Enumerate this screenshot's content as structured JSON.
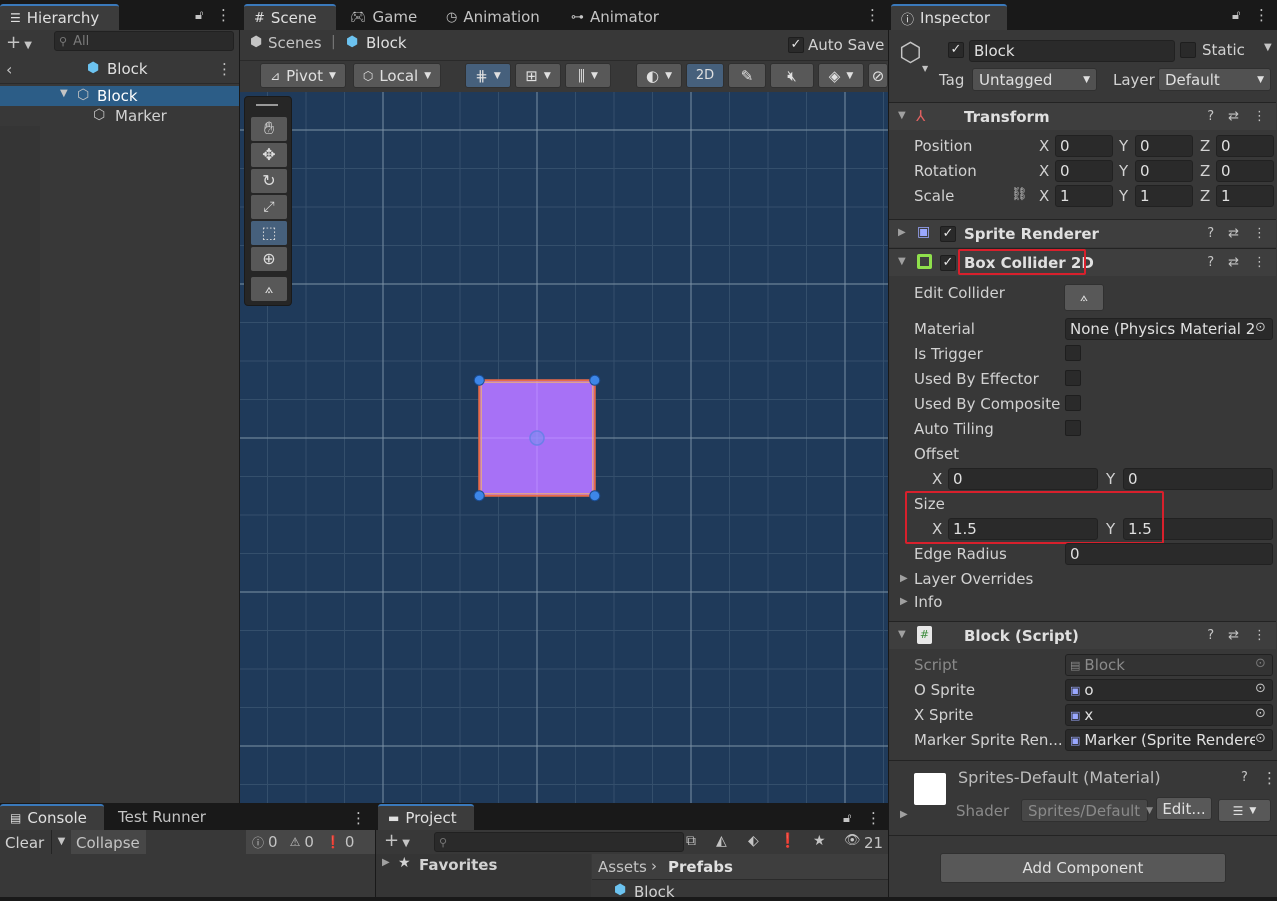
{
  "hierarchy": {
    "tab": "Hierarchy",
    "search_placeholder": "All",
    "scene_title": "Block",
    "items": [
      {
        "label": "Block"
      },
      {
        "label": "Marker"
      }
    ]
  },
  "scene": {
    "tabs": [
      "Scene",
      "Game",
      "Animation",
      "Animator"
    ],
    "breadcrumb_root": "Scenes",
    "breadcrumb_current": "Block",
    "auto_save_label": "Auto Save",
    "pivot_label": "Pivot",
    "local_label": "Local",
    "mode_2d": "2D",
    "grid_color": "#7f94a8",
    "background_color": "#1f3a5a",
    "sprite_color": "#a771f6"
  },
  "inspector": {
    "tab": "Inspector",
    "object_name": "Block",
    "static_label": "Static",
    "tag_label": "Tag",
    "tag_value": "Untagged",
    "layer_label": "Layer",
    "layer_value": "Default",
    "transform": {
      "title": "Transform",
      "position_label": "Position",
      "rotation_label": "Rotation",
      "scale_label": "Scale",
      "axis_x": "X",
      "axis_y": "Y",
      "axis_z": "Z",
      "position": [
        "0",
        "0",
        "0"
      ],
      "rotation": [
        "0",
        "0",
        "0"
      ],
      "scale": [
        "1",
        "1",
        "1"
      ]
    },
    "sprite_renderer": {
      "title": "Sprite Renderer"
    },
    "box_collider": {
      "title": "Box Collider 2D",
      "edit_collider_label": "Edit Collider",
      "material_label": "Material",
      "material_value": "None (Physics Material 2",
      "is_trigger_label": "Is Trigger",
      "used_by_effector_label": "Used By Effector",
      "used_by_composite_label": "Used By Composite",
      "auto_tiling_label": "Auto Tiling",
      "offset_label": "Offset",
      "offset_x": "0",
      "offset_y": "0",
      "size_label": "Size",
      "size_x": "1.5",
      "size_y": "1.5",
      "edge_radius_label": "Edge Radius",
      "edge_radius_value": "0",
      "layer_overrides_label": "Layer Overrides",
      "info_label": "Info"
    },
    "block_script": {
      "title": "Block (Script)",
      "script_label": "Script",
      "script_value": "Block",
      "o_sprite_label": "O Sprite",
      "o_sprite_value": "o",
      "x_sprite_label": "X Sprite",
      "x_sprite_value": "x",
      "marker_label": "Marker Sprite Ren...",
      "marker_value": "Marker (Sprite Rendere"
    },
    "material": {
      "title": "Sprites-Default (Material)",
      "shader_label": "Shader",
      "shader_value": "Sprites/Default",
      "edit_label": "Edit..."
    },
    "add_component_label": "Add Component"
  },
  "console": {
    "tabs": [
      "Console",
      "Test Runner"
    ],
    "clear_label": "Clear",
    "collapse_label": "Collapse",
    "info_count": "0",
    "warn_count": "0",
    "error_count": "0"
  },
  "project": {
    "tab": "Project",
    "favorites_label": "Favorites",
    "breadcrumb_root": "Assets",
    "breadcrumb_current": "Prefabs",
    "asset_item": "Block",
    "hidden_count": "21"
  }
}
